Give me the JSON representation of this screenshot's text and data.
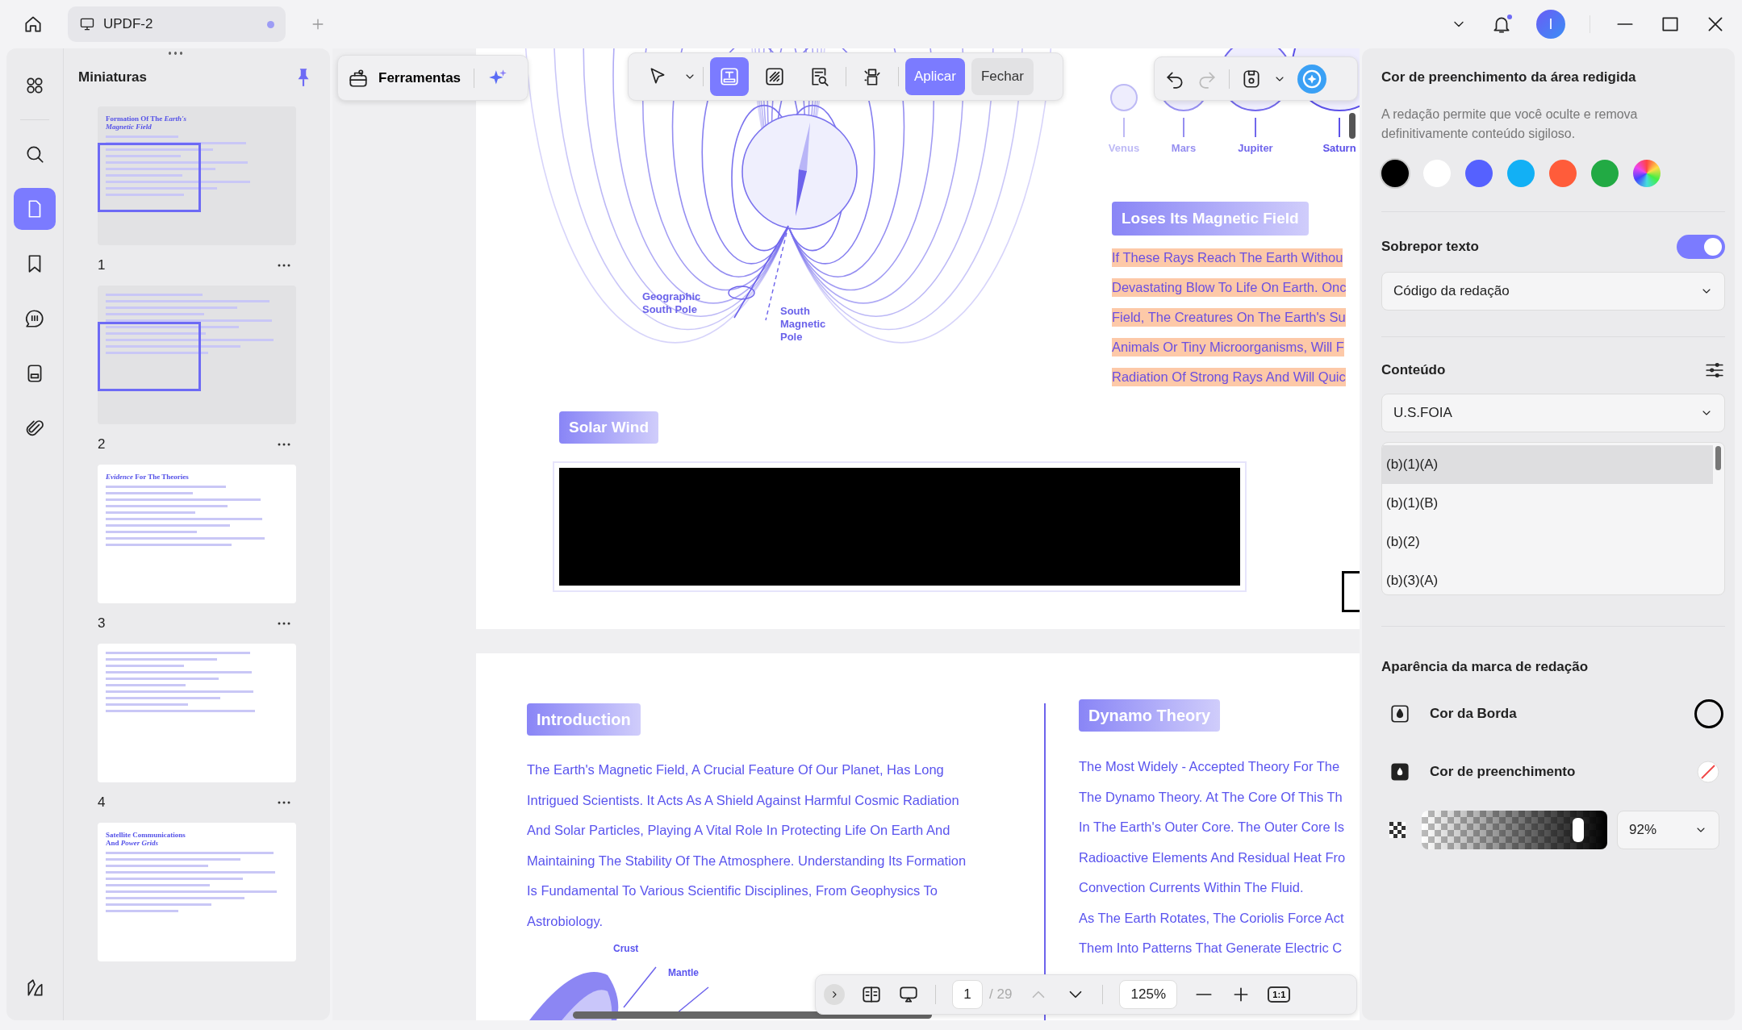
{
  "tab_bar": {
    "tabs": [
      {
        "label": "UPDF-2",
        "selected": true,
        "unsaved": true
      }
    ]
  },
  "title_bar": {
    "avatar_initial": "I",
    "notification": true
  },
  "rail": {
    "items": [
      {
        "kind": "grid",
        "selected": false
      },
      {
        "kind": "search",
        "selected": false
      },
      {
        "kind": "pages",
        "selected": true
      },
      {
        "kind": "bookmark",
        "selected": false
      },
      {
        "kind": "comment",
        "selected": false
      },
      {
        "kind": "form",
        "selected": false
      },
      {
        "kind": "attachment",
        "selected": false
      }
    ]
  },
  "thumbnails": {
    "title": "Miniaturas",
    "pages": [
      {
        "number": "1",
        "title": "Formation Of The *Earth's Magnetic Field*",
        "in_view": true
      },
      {
        "number": "2",
        "in_view": true
      },
      {
        "number": "3",
        "title": "*Evidence* For The Theories",
        "in_view": false
      },
      {
        "number": "4",
        "in_view": false
      },
      {
        "title": "Satellite Communications And *Power Grids*",
        "in_view": false
      }
    ]
  },
  "tools_bar": {
    "label": "Ferramentas"
  },
  "redact_toolbar": {
    "tools": [
      {
        "kind": "select",
        "selected": false
      },
      {
        "kind": "redact_text",
        "selected": true
      },
      {
        "kind": "redact_area",
        "selected": false
      },
      {
        "kind": "search_redact",
        "selected": false
      },
      {
        "kind": "redact_pages",
        "selected": false
      }
    ],
    "apply": "Aplicar",
    "close": "Fechar"
  },
  "history_toolbar": {
    "undo_enabled": true,
    "redo_enabled": false
  },
  "document": {
    "page_1": {
      "diagram_labels": [
        "Geographic South Pole",
        "South Magnetic Pole"
      ],
      "planets": [
        {
          "name": "Venus",
          "color": "#bdb9f5"
        },
        {
          "name": "Mars",
          "color": "#958ef0"
        },
        {
          "name": "Jupiter",
          "color": "#7268ec"
        },
        {
          "name": "Saturn",
          "color": "#5b50e8"
        }
      ],
      "section_heading": "Loses Its Magnetic Field",
      "highlighted_lines": [
        "If These Rays Reach The Earth Withou",
        "Devastating Blow To Life On Earth. Onc",
        "Field, The Creatures On The Earth's Su",
        "Animals Or Tiny Microorganisms, Will F",
        "Radiation Of Strong Rays And Will Quic"
      ],
      "solar_wind_heading": "Solar Wind"
    },
    "page_2": {
      "intro_heading": "Introduction",
      "intro_lines": [
        "The Earth's Magnetic Field, A Crucial Feature Of Our Planet, Has Long",
        "Intrigued Scientists. It Acts As A Shield Against Harmful Cosmic Radiation",
        "And Solar Particles, Playing A Vital Role In Protecting Life On Earth And",
        "Maintaining The Stability Of The Atmosphere. Understanding Its Formation",
        "Is Fundamental To Various Scientific Disciplines, From Geophysics To",
        "Astrobiology."
      ],
      "figure_labels": [
        "Crust",
        "Mantle"
      ],
      "dynamo_heading": "Dynamo Theory",
      "dynamo_lines": [
        "The Most Widely - Accepted Theory For The",
        "The Dynamo Theory. At The Core Of This Th",
        "In The Earth's Outer Core. The Outer Core Is",
        "Radioactive Elements And Residual Heat Fro",
        "Convection Currents Within The Fluid.",
        "As The Earth Rotates, The Coriolis Force Act",
        "Them Into Patterns That Generate Electric C"
      ]
    }
  },
  "page_nav": {
    "current": "1",
    "total": "/ 29",
    "zoom": "125%",
    "actual_size": "1:1"
  },
  "redaction_panel": {
    "fill_title": "Cor de preenchimento da área redigida",
    "fill_description": "A redação permite que você oculte e remova definitivamente conteúdo sigiloso.",
    "swatches": [
      {
        "kind": "solid",
        "color": "#000000",
        "selected": true
      },
      {
        "kind": "solid",
        "color": "#ffffff",
        "selected": false
      },
      {
        "kind": "solid",
        "color": "#5561ff",
        "selected": false
      },
      {
        "kind": "solid",
        "color": "#12b0f5",
        "selected": false
      },
      {
        "kind": "solid",
        "color": "#ff5c3a",
        "selected": false
      },
      {
        "kind": "solid",
        "color": "#22aa44",
        "selected": false
      },
      {
        "kind": "spectrum",
        "selected": false
      }
    ],
    "overlay": {
      "label": "Sobrepor texto",
      "on": true,
      "value": "Código da redação"
    },
    "content": {
      "label": "Conteúdo",
      "value": "U.S.FOIA",
      "items": [
        {
          "label": "(b)(1)(A)",
          "selected": true
        },
        {
          "label": "(b)(1)(B)",
          "selected": false
        },
        {
          "label": "(b)(2)",
          "selected": false
        },
        {
          "label": "(b)(3)(A)",
          "selected": false
        }
      ]
    },
    "appearance": {
      "title": "Aparência da marca de redação",
      "rows": [
        {
          "kind": "border",
          "label": "Cor da Borda",
          "color": "#000000"
        },
        {
          "kind": "fill",
          "label": "Cor de preenchimento",
          "empty": true
        }
      ],
      "opacity": {
        "level": 0.92,
        "value": "92%"
      }
    }
  }
}
